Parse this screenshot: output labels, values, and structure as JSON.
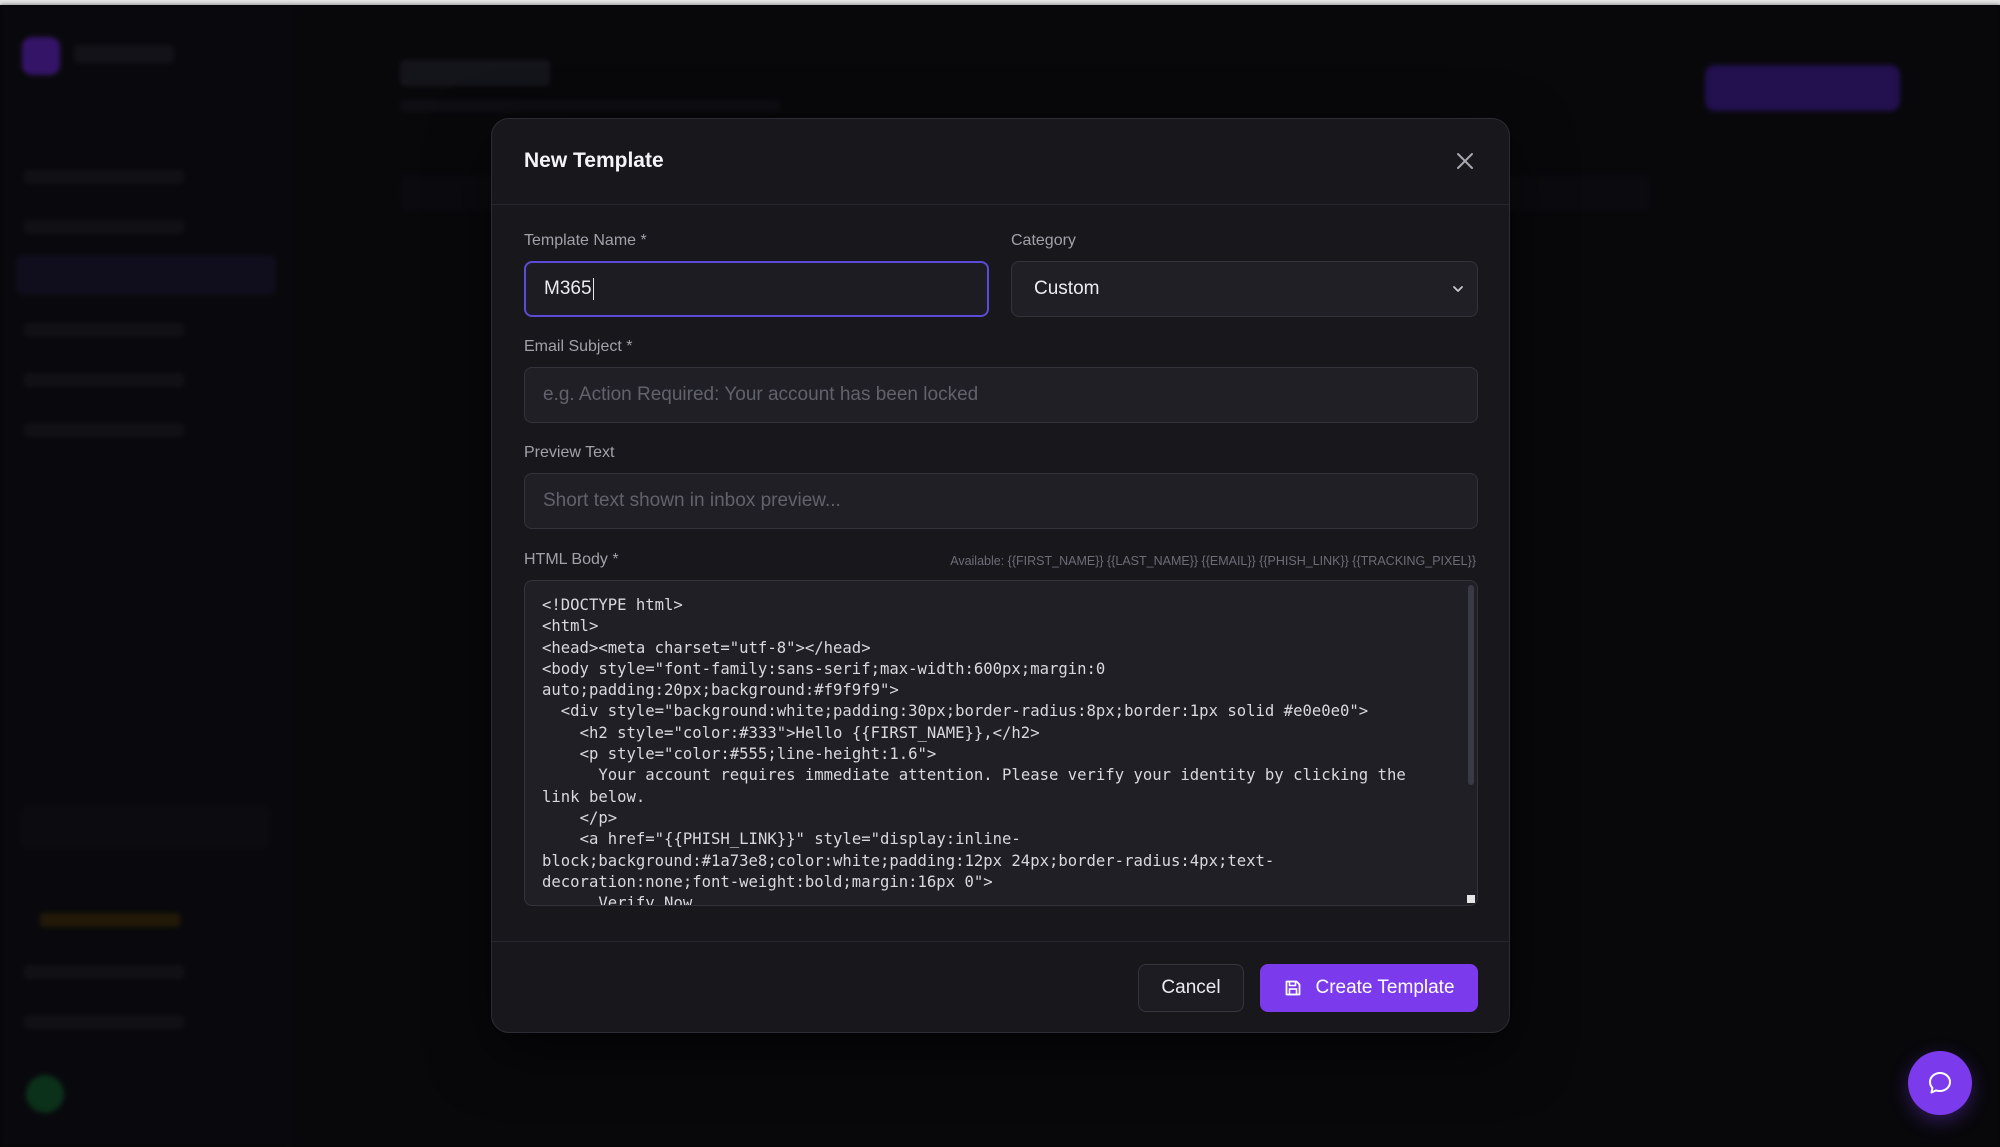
{
  "modal": {
    "title": "New Template",
    "template_name": {
      "label": "Template Name *",
      "value": "M365"
    },
    "category": {
      "label": "Category",
      "value": "Custom"
    },
    "email_subject": {
      "label": "Email Subject *",
      "value": "",
      "placeholder": "e.g. Action Required: Your account has been locked"
    },
    "preview_text": {
      "label": "Preview Text",
      "value": "",
      "placeholder": "Short text shown in inbox preview..."
    },
    "html_body": {
      "label": "HTML Body *",
      "available_vars": "Available: {{FIRST_NAME}} {{LAST_NAME}} {{EMAIL}} {{PHISH_LINK}} {{TRACKING_PIXEL}}",
      "value": "<!DOCTYPE html>\n<html>\n<head><meta charset=\"utf-8\"></head>\n<body style=\"font-family:sans-serif;max-width:600px;margin:0\nauto;padding:20px;background:#f9f9f9\">\n  <div style=\"background:white;padding:30px;border-radius:8px;border:1px solid #e0e0e0\">\n    <h2 style=\"color:#333\">Hello {{FIRST_NAME}},</h2>\n    <p style=\"color:#555;line-height:1.6\">\n      Your account requires immediate attention. Please verify your identity by clicking the\nlink below.\n    </p>\n    <a href=\"{{PHISH_LINK}}\" style=\"display:inline-\nblock;background:#1a73e8;color:white;padding:12px 24px;border-radius:4px;text-\ndecoration:none;font-weight:bold;margin:16px 0\">\n      Verify Now"
    },
    "buttons": {
      "cancel": "Cancel",
      "create": "Create Template"
    },
    "icons": {
      "close": "close-icon",
      "chevron": "chevron-down-icon",
      "save": "save-icon"
    }
  },
  "chat": {
    "icon": "chat-bubble-icon"
  },
  "colors": {
    "accent": "#7c3aed",
    "focus_ring": "#5b4bd6",
    "modal_bg": "#17171c",
    "input_bg": "#1f1f25"
  }
}
